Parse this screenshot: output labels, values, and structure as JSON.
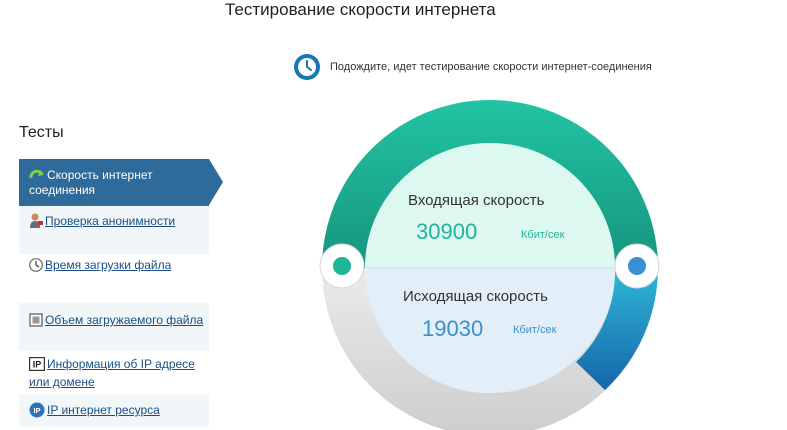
{
  "page": {
    "title": "Тестирование скорости интернета"
  },
  "status": {
    "text": "Подождите, идет тестирование скорости интернет-соединения",
    "icon": "clock-icon"
  },
  "sidebar": {
    "title": "Тесты",
    "items": [
      {
        "label": "Скорость интернет соединения",
        "icon": "refresh-arrow-icon",
        "active": true
      },
      {
        "label": "Проверка анонимности",
        "icon": "user-icon"
      },
      {
        "label": "Время загрузки файла",
        "icon": "clock-icon"
      },
      {
        "label": "Объем загружаемого файла",
        "icon": "file-size-icon"
      },
      {
        "label": "Информация об IP адресе или домене",
        "icon": "ip-badge-icon"
      },
      {
        "label": "IP интернет ресурса",
        "icon": "ip-globe-icon"
      }
    ]
  },
  "gauge": {
    "download": {
      "label": "Входящая скорость",
      "value": "30900",
      "unit": "Кбит/сек"
    },
    "upload": {
      "label": "Исходящая скорость",
      "value": "19030",
      "unit": "Кбит/сек"
    }
  },
  "colors": {
    "accent_nav": "#2e6a9a",
    "download": "#1fb597",
    "upload": "#2f8fc9",
    "upload_value": "#3b8fcb",
    "link": "#1a4f86"
  }
}
